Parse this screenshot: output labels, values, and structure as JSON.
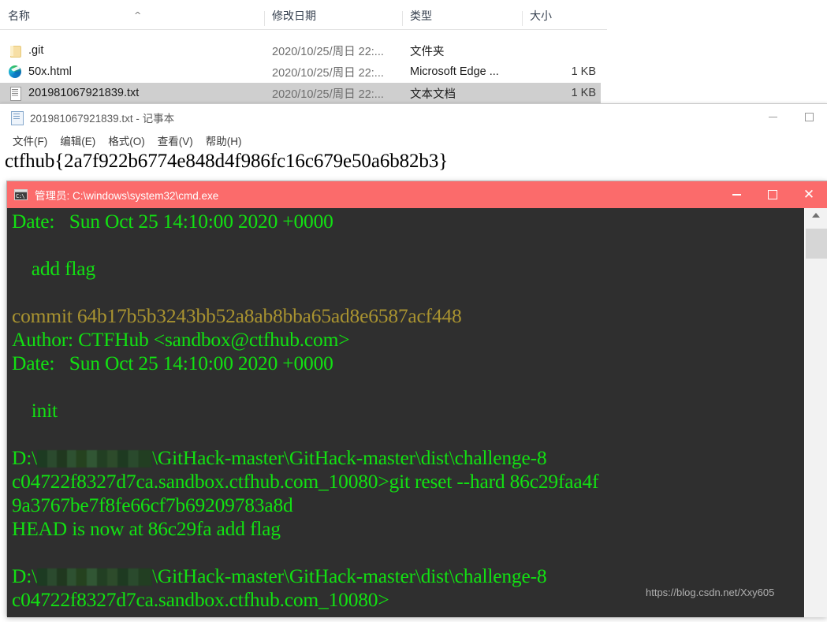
{
  "colors": {
    "cmd_titlebar": "#fb6b6b",
    "terminal_bg": "#2f2f2f",
    "terminal_fg": "#12e012",
    "terminal_yellow": "#a99330",
    "selection": "#cfcfcf"
  },
  "explorer": {
    "columns": [
      {
        "label": "名称",
        "sort": "^"
      },
      {
        "label": "修改日期"
      },
      {
        "label": "类型"
      },
      {
        "label": "大小"
      }
    ],
    "rows": [
      {
        "icon": "folder-icon",
        "name": ".git",
        "date": "2020/10/25/周日 22:...",
        "type": "文件夹",
        "size": ""
      },
      {
        "icon": "edge-icon",
        "name": "50x.html",
        "date": "2020/10/25/周日 22:...",
        "type": "Microsoft Edge ...",
        "size": "1 KB"
      },
      {
        "icon": "text-file-icon",
        "name": "201981067921839.txt",
        "date": "2020/10/25/周日 22:...",
        "type": "文本文档",
        "size": "1 KB",
        "selected": true
      }
    ]
  },
  "notepad": {
    "title": "201981067921839.txt - 记事本",
    "menus": [
      {
        "label": "文件(F)"
      },
      {
        "label": "编辑(E)"
      },
      {
        "label": "格式(O)"
      },
      {
        "label": "查看(V)"
      },
      {
        "label": "帮助(H)"
      }
    ],
    "controls": {
      "minimize": "minimize-icon",
      "maximize": "maximize-icon"
    },
    "content": "ctfhub{2a7f922b6774e848d4f986fc16c679e50a6b82b3}"
  },
  "cmd": {
    "title": "管理员: C:\\windows\\system32\\cmd.exe",
    "icon_glyph": "C:\\",
    "controls": {
      "minimize": "minimize-icon",
      "maximize": "maximize-icon",
      "close": "close-icon"
    },
    "scrollbar": {
      "arrow_up": "chevron-up-icon"
    },
    "lines": [
      {
        "text": "Date:   Sun Oct 25 14:10:00 2020 +0000",
        "color": "green"
      },
      {
        "text": "",
        "color": "green"
      },
      {
        "text": "    add flag",
        "color": "green"
      },
      {
        "text": "",
        "color": "green"
      },
      {
        "text": "commit 64b17b5b3243bb52a8ab8bba65ad8e6587acf448",
        "color": "yellow"
      },
      {
        "text": "Author: CTFHub <sandbox@ctfhub.com>",
        "color": "green"
      },
      {
        "text": "Date:   Sun Oct 25 14:10:00 2020 +0000",
        "color": "green"
      },
      {
        "text": "",
        "color": "green"
      },
      {
        "text": "    init",
        "color": "green"
      },
      {
        "text": "",
        "color": "green"
      },
      {
        "text": "@REDACT@PATH_PREFIX",
        "color": "green"
      },
      {
        "text": "c04722f8327d7ca.sandbox.ctfhub.com_10080>git reset --hard 86c29faa4f",
        "color": "green"
      },
      {
        "text": "9a3767be7f8fe66cf7b69209783a8d",
        "color": "green"
      },
      {
        "text": "HEAD is now at 86c29fa add flag",
        "color": "green"
      },
      {
        "text": "",
        "color": "green"
      },
      {
        "text": "@REDACT@PATH_PREFIX",
        "color": "green"
      },
      {
        "text": "c04722f8327d7ca.sandbox.ctfhub.com_10080>",
        "color": "green"
      }
    ],
    "path_prefix_start": "D:\\",
    "path_prefix_end": "\\GitHack-master\\GitHack-master\\dist\\challenge-8"
  },
  "watermark": "https://blog.csdn.net/Xxy605"
}
